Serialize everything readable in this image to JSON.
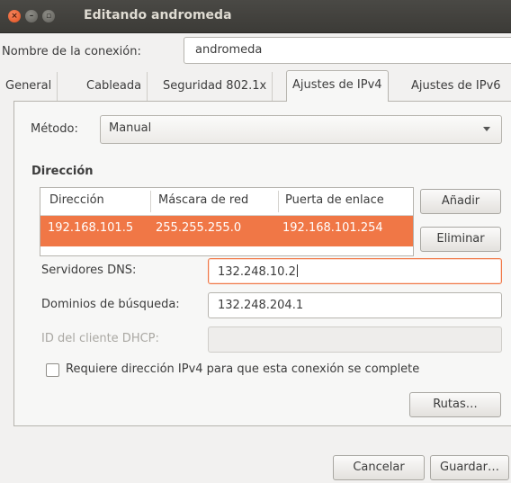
{
  "window": {
    "title": "Editando andromeda"
  },
  "connection": {
    "name_label": "Nombre de la conexión:",
    "name_value": "andromeda"
  },
  "tabs": [
    {
      "label": "General"
    },
    {
      "label": "Cableada"
    },
    {
      "label": "Seguridad 802.1x"
    },
    {
      "label": "Ajustes de IPv4"
    },
    {
      "label": "Ajustes de IPv6"
    }
  ],
  "active_tab": "Ajustes de IPv4",
  "ipv4": {
    "method_label": "Método:",
    "method_value": "Manual",
    "address_section_title": "Dirección",
    "table": {
      "headers": [
        "Dirección",
        "Máscara de red",
        "Puerta de enlace"
      ],
      "rows": [
        [
          "192.168.101.5",
          "255.255.255.0",
          "192.168.101.254"
        ]
      ]
    },
    "add_button": "Añadir",
    "delete_button": "Eliminar",
    "dns_label": "Servidores DNS:",
    "dns_value": "132.248.10.2",
    "search_domains_label": "Dominios de búsqueda:",
    "search_domains_value": "132.248.204.1",
    "dhcp_client_id_label": "ID del cliente DHCP:",
    "dhcp_client_id_value": "",
    "require_ipv4_label": "Requiere dirección IPv4 para que esta conexión se complete",
    "require_ipv4_checked": false,
    "routes_button": "Rutas…"
  },
  "footer": {
    "cancel_button": "Cancelar",
    "save_button": "Guardar…"
  },
  "colors": {
    "accent": "#f07746",
    "titlebar": "#3c3b37",
    "close_button": "#e0501f"
  }
}
